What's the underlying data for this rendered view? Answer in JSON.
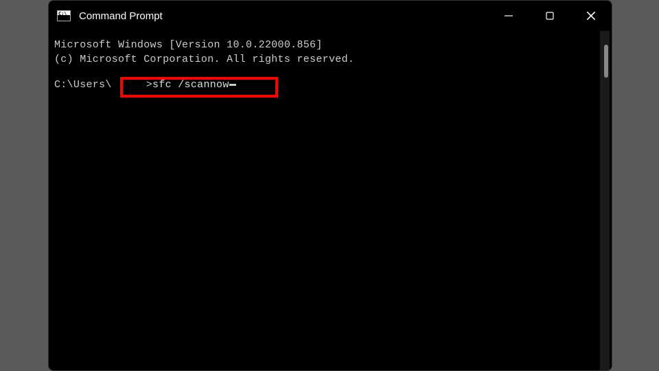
{
  "window": {
    "title": "Command Prompt"
  },
  "terminal": {
    "line1": "Microsoft Windows [Version 10.0.22000.856]",
    "line2": "(c) Microsoft Corporation. All rights reserved.",
    "prompt_path": "C:\\Users\\",
    "prompt_suffix": ">",
    "command": "sfc /scannow"
  }
}
